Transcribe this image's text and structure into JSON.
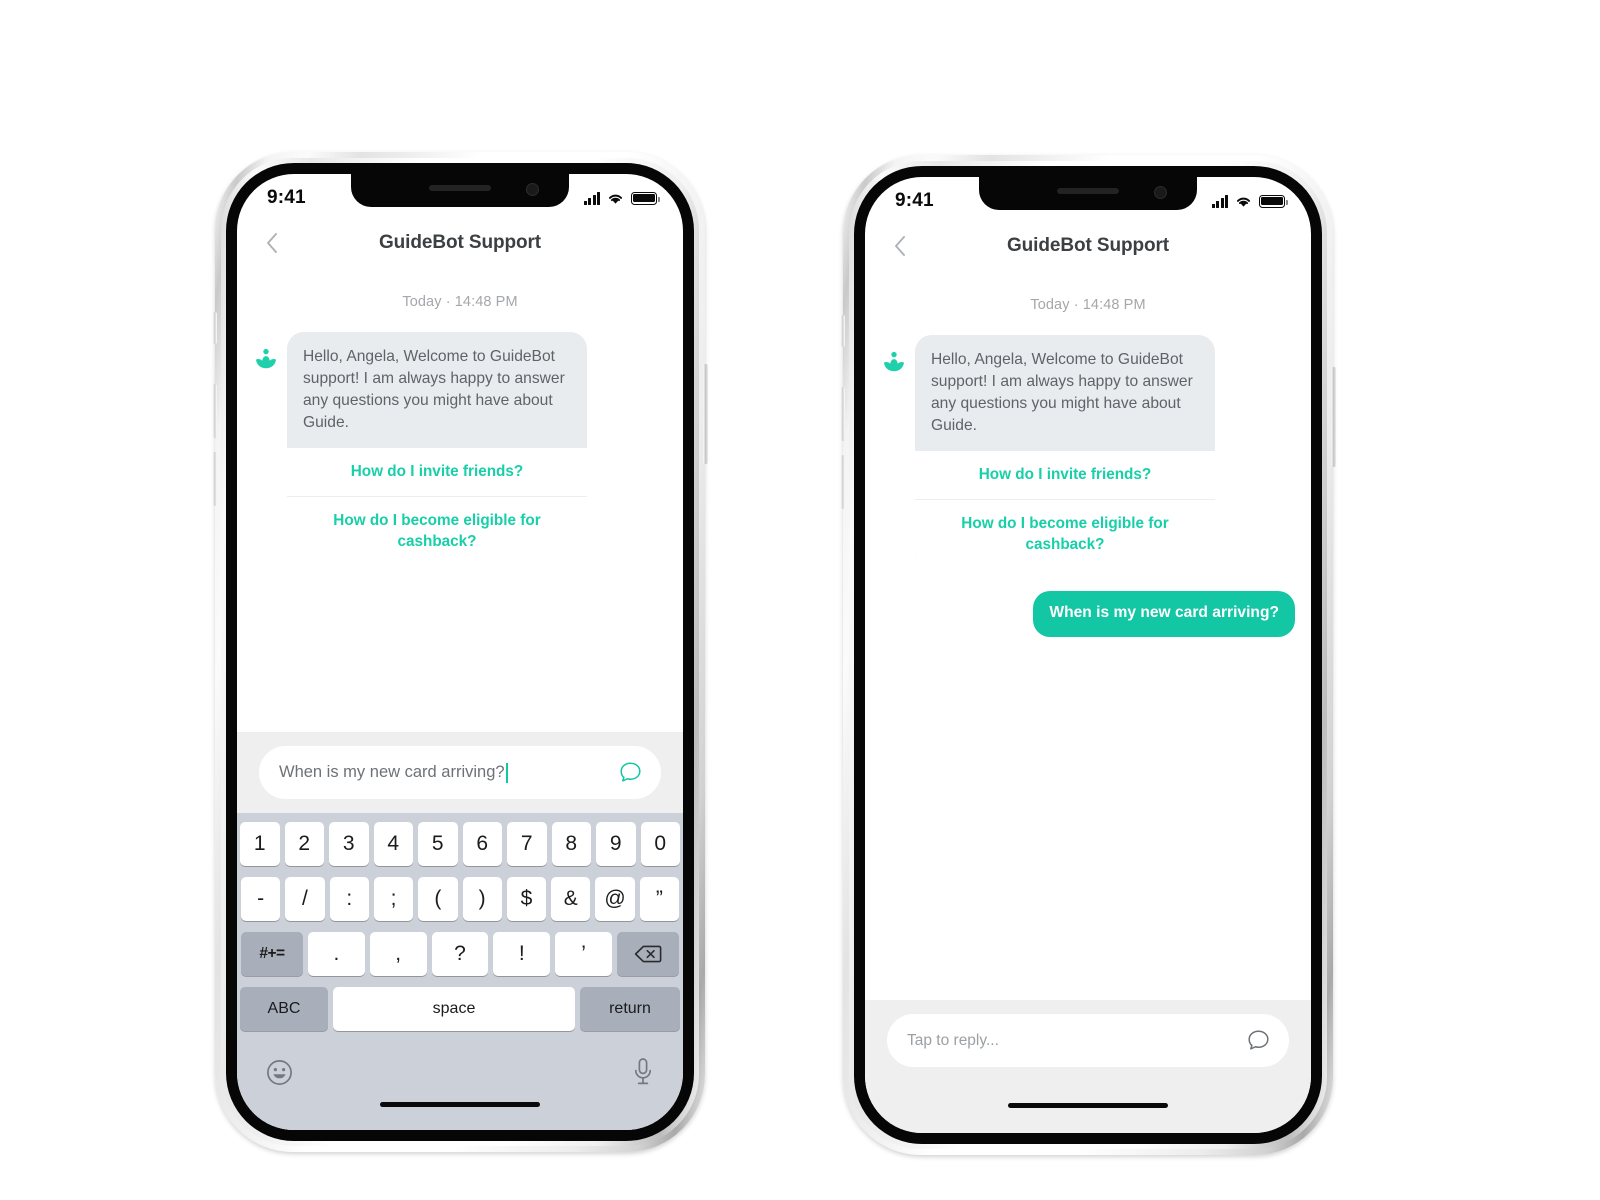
{
  "screens": [
    {
      "id": "composing",
      "status_bar": {
        "time": "9:41",
        "signal_icon": "cellular-signal-icon",
        "wifi_icon": "wifi-icon",
        "battery_icon": "battery-icon"
      },
      "nav": {
        "back_icon": "chevron-left-icon",
        "title": "GuideBot Support"
      },
      "conversation": {
        "timestamp": "Today · 14:48 PM",
        "bot_avatar_icon": "guidebot-lotus-avatar-icon",
        "bot_message": "Hello, Angela, Welcome to GuideBot support!  I am always happy to answer any questions you might have about Guide.",
        "quick_replies": [
          "How do I invite friends?",
          "How do I become eligible for cashback?"
        ],
        "user_messages": []
      },
      "input": {
        "value": "When is my new card arriving?",
        "placeholder": "Tap to reply...",
        "has_caret": true,
        "send_icon": "chat-bubble-send-icon",
        "send_icon_color": "#13c6a4"
      },
      "keyboard": {
        "visible": true,
        "rows": [
          [
            "1",
            "2",
            "3",
            "4",
            "5",
            "6",
            "7",
            "8",
            "9",
            "0"
          ],
          [
            "-",
            "/",
            ":",
            ";",
            "(",
            ")",
            "$",
            "&",
            "@",
            "”"
          ],
          [
            "#+=",
            ".",
            ",",
            "?",
            "!",
            "’",
            "backspace-icon"
          ],
          [
            "ABC",
            "space",
            "return"
          ]
        ],
        "emoji_icon": "emoji-smiley-icon",
        "mic_icon": "microphone-icon"
      }
    },
    {
      "id": "sent",
      "status_bar": {
        "time": "9:41",
        "signal_icon": "cellular-signal-icon",
        "wifi_icon": "wifi-icon",
        "battery_icon": "battery-icon"
      },
      "nav": {
        "back_icon": "chevron-left-icon",
        "title": "GuideBot Support"
      },
      "conversation": {
        "timestamp": "Today · 14:48 PM",
        "bot_avatar_icon": "guidebot-lotus-avatar-icon",
        "bot_message": "Hello, Angela, Welcome to GuideBot support!  I am always happy to answer any questions you might have about Guide.",
        "quick_replies": [
          "How do I invite friends?",
          "How do I become eligible for cashback?"
        ],
        "user_messages": [
          "When is my new card arriving?"
        ]
      },
      "input": {
        "value": "",
        "placeholder": "Tap to reply...",
        "has_caret": false,
        "send_icon": "chat-bubble-send-icon",
        "send_icon_color": "#6e7276"
      },
      "keyboard": {
        "visible": false
      }
    }
  ],
  "theme": {
    "accent": "#13c6a4",
    "quick_reply_color": "#17cfa8",
    "bot_bubble_bg": "#e9ecef",
    "bot_text_color": "#5f6368",
    "input_bar_bg": "#efefef",
    "keyboard_bg": "#ccd0d8",
    "title_color": "#3c4043",
    "timestamp_color": "#a4a7ab"
  }
}
